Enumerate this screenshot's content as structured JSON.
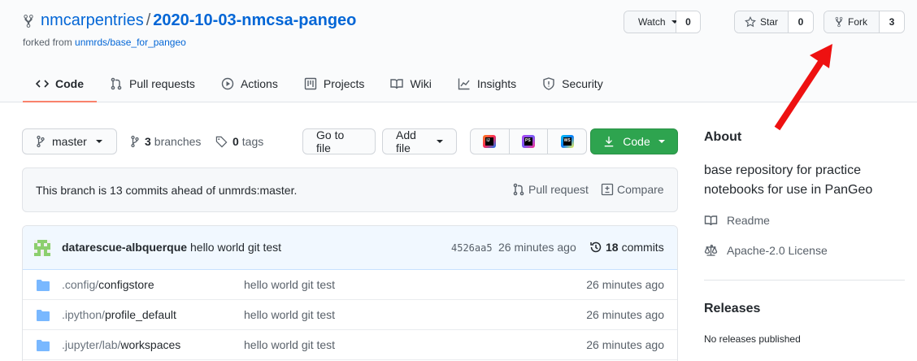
{
  "repo": {
    "owner": "nmcarpentries",
    "separator": "/",
    "name": "2020-10-03-nmcsa-pangeo",
    "forked_prefix": "forked from ",
    "forked_from": "unmrds/base_for_pangeo"
  },
  "header_actions": {
    "watch_label": "Watch",
    "watch_count": "0",
    "star_label": "Star",
    "star_count": "0",
    "fork_label": "Fork",
    "fork_count": "3"
  },
  "tabs": [
    {
      "label": "Code",
      "icon": "code-icon"
    },
    {
      "label": "Pull requests",
      "icon": "pull-request-icon"
    },
    {
      "label": "Actions",
      "icon": "play-icon"
    },
    {
      "label": "Projects",
      "icon": "project-icon"
    },
    {
      "label": "Wiki",
      "icon": "book-icon"
    },
    {
      "label": "Insights",
      "icon": "graph-icon"
    },
    {
      "label": "Security",
      "icon": "shield-icon"
    }
  ],
  "toolbar": {
    "branch": "master",
    "branches_count": "3",
    "branches_label": "branches",
    "tags_count": "0",
    "tags_label": "tags",
    "goto_file": "Go to file",
    "add_file": "Add file",
    "code_label": "Code",
    "ide_icons": [
      "intellij-icon",
      "phpstorm-icon",
      "webstorm-icon"
    ],
    "ide_letters": [
      "IJ",
      "PS",
      "WS"
    ]
  },
  "ahead": {
    "message": "This branch is 13 commits ahead of unmrds:master.",
    "pull_request": "Pull request",
    "compare": "Compare"
  },
  "latest_commit": {
    "author": "datarescue-albquerque",
    "message": "hello world git test",
    "sha": "4526aa5",
    "time": "26 minutes ago",
    "count": "18",
    "count_label": "commits"
  },
  "files": [
    {
      "prefix": ".config/",
      "name": "configstore",
      "message": "hello world git test",
      "time": "26 minutes ago"
    },
    {
      "prefix": ".ipython/",
      "name": "profile_default",
      "message": "hello world git test",
      "time": "26 minutes ago"
    },
    {
      "prefix": ".jupyter/lab/",
      "name": "workspaces",
      "message": "hello world git test",
      "time": "26 minutes ago"
    }
  ],
  "sidebar": {
    "about_title": "About",
    "description": "base repository for practice notebooks for use in PanGeo",
    "readme": "Readme",
    "license": "Apache-2.0 License",
    "releases_title": "Releases",
    "releases_text": "No releases published"
  },
  "colors": {
    "accent": "#0366d6",
    "primary_button": "#2ea44f",
    "tab_underline": "#f9826c",
    "annotation_arrow": "#ee1111"
  }
}
